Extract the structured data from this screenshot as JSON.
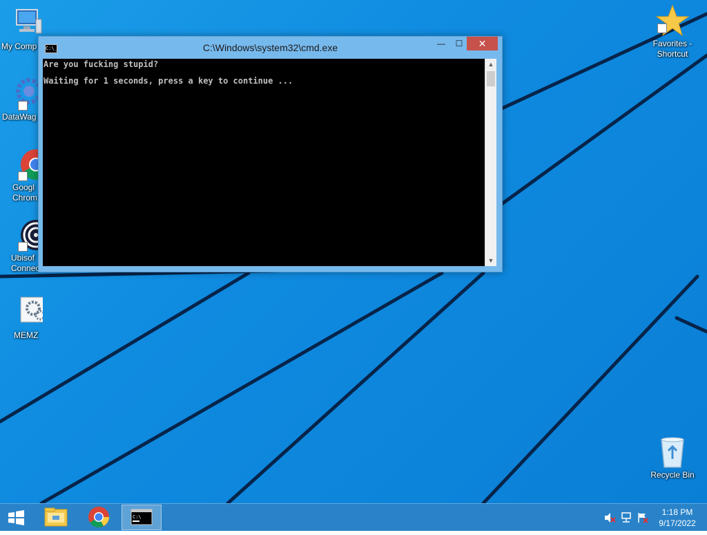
{
  "desktop": {
    "icons_left": [
      {
        "label": "My Comp",
        "icon": "computer-icon"
      },
      {
        "label": "DataWag",
        "icon": "gear-app-icon"
      },
      {
        "label": "Googl\nChrom",
        "icon": "chrome-icon"
      },
      {
        "label": "Ubisof\nConnec",
        "icon": "ubisoft-icon"
      },
      {
        "label": "MEMZ",
        "icon": "settings-file-icon"
      }
    ],
    "icons_right": [
      {
        "label": "Favorites -\nShortcut",
        "icon": "star-icon"
      },
      {
        "label": "Recycle Bin",
        "icon": "recycle-bin-icon"
      }
    ]
  },
  "cmd_window": {
    "title": "C:\\Windows\\system32\\cmd.exe",
    "icon_text": "C:\\_",
    "minimize_label": "—",
    "maximize_label": "☐",
    "close_label": "✕",
    "console_lines": [
      "Are you fucking stupid?",
      "",
      "Waiting for 1 seconds, press a key to continue ..."
    ]
  },
  "taskbar": {
    "start_icon": "windows-logo-icon",
    "tasks": [
      {
        "name": "File Explorer",
        "icon": "folder-icon"
      },
      {
        "name": "Google Chrome",
        "icon": "chrome-icon"
      },
      {
        "name": "Command Prompt",
        "icon": "cmd-icon",
        "active": true
      }
    ],
    "tray": [
      "volume-muted-icon",
      "network-icon",
      "action-center-flag-icon"
    ],
    "time": "1:18 PM",
    "date": "9/17/2022"
  },
  "colors": {
    "wallpaper": "#1592e3",
    "titlebar": "#76b9ed",
    "close_button": "#c7514b",
    "console_bg": "#000000",
    "console_text": "#c0c0c0",
    "taskbar": "#2a83c9"
  }
}
